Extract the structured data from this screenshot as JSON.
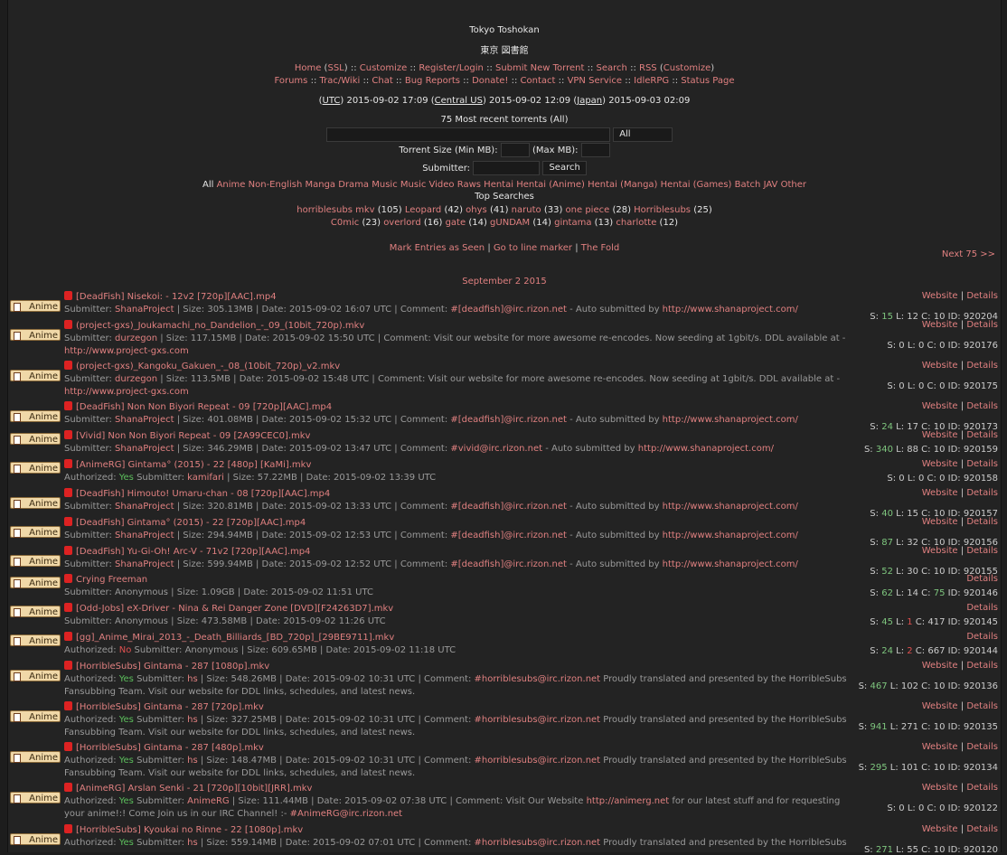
{
  "header": {
    "title": "Tokyo Toshokan",
    "title_jp": "東京 図書館",
    "nav1": [
      "Home",
      "SSL",
      "Customize",
      "Register/Login",
      "Submit New Torrent",
      "Search",
      "RSS",
      "Customize"
    ],
    "nav2": [
      "Forums",
      "Trac/Wiki",
      "Chat",
      "Bug Reports",
      "Donate!",
      "Contact",
      "VPN Service",
      "IdleRPG",
      "Status Page"
    ],
    "time_utc_label": "UTC",
    "time_utc": "2015-09-02 17:09",
    "time_cus_label": "Central US",
    "time_cus": "2015-09-02 12:09",
    "time_jp_label": "Japan",
    "time_jp": "2015-09-03 02:09"
  },
  "search": {
    "recent_label": "75 Most recent torrents (All)",
    "category_value": "All",
    "size_label": "Torrent Size (Min MB):",
    "max_label": "(Max MB):",
    "submitter_label": "Submitter:",
    "search_button": "Search"
  },
  "categories": {
    "all": "All",
    "items": [
      "Anime",
      "Non-English",
      "Manga",
      "Drama",
      "Music",
      "Music Video",
      "Raws",
      "Hentai",
      "Hentai (Anime)",
      "Hentai (Manga)",
      "Hentai (Games)",
      "Batch",
      "JAV",
      "Other"
    ]
  },
  "top_searches": {
    "label": "Top Searches",
    "row1": [
      [
        "horriblesubs mkv",
        "(105)"
      ],
      [
        "Leopard",
        "(42)"
      ],
      [
        "ohys",
        "(41)"
      ],
      [
        "naruto",
        "(33)"
      ],
      [
        "one piece",
        "(28)"
      ],
      [
        "Horriblesubs",
        "(25)"
      ]
    ],
    "row2": [
      [
        "C0mic",
        "(23)"
      ],
      [
        "overlord",
        "(16)"
      ],
      [
        "gate",
        "(14)"
      ],
      [
        "gUNDAM",
        "(14)"
      ],
      [
        "gintama",
        "(13)"
      ],
      [
        "charlotte",
        "(12)"
      ]
    ]
  },
  "markers": {
    "mark_seen": "Mark Entries as Seen",
    "goto": "Go to line marker",
    "fold": "The Fold",
    "next": "Next 75 >>"
  },
  "date_header": "September 2 2015",
  "cat_label": "Anime",
  "link_website": "Website",
  "link_details": "Details",
  "torrents": [
    {
      "name": "[DeadFish] Nisekoi: - 12v2 [720p][AAC].mp4",
      "info": "Submitter: ShanaProject | Size: 305.13MB | Date: 2015-09-02 16:07 UTC | Comment: #[deadfish]@irc.rizon.net - Auto submitted by http://www.shanaproject.com/",
      "s": "15",
      "l": "12",
      "c": "10",
      "id": "920204"
    },
    {
      "name": "(project-gxs)_Joukamachi_no_Dandelion_-_09_(10bit_720p).mkv",
      "info": "Submitter: durzegon | Size: 117.15MB | Date: 2015-09-02 15:50 UTC | Comment: Visit our website for more awesome re-encodes. Now seeding at 1gbit/s. DDL available at - http://www.project-gxs.com",
      "s": "0",
      "l": "0",
      "c": "0",
      "id": "920176"
    },
    {
      "name": "(project-gxs)_Kangoku_Gakuen_-_08_(10bit_720p)_v2.mkv",
      "info": "Submitter: durzegon | Size: 113.5MB | Date: 2015-09-02 15:48 UTC | Comment: Visit our website for more awesome re-encodes. Now seeding at 1gbit/s. DDL available at - http://www.project-gxs.com",
      "s": "0",
      "l": "0",
      "c": "0",
      "id": "920175"
    },
    {
      "name": "[DeadFish] Non Non Biyori Repeat - 09 [720p][AAC].mp4",
      "info": "Submitter: ShanaProject | Size: 401.08MB | Date: 2015-09-02 15:32 UTC | Comment: #[deadfish]@irc.rizon.net - Auto submitted by http://www.shanaproject.com/",
      "s": "24",
      "l": "17",
      "c": "10",
      "id": "920173"
    },
    {
      "name": "[Vivid] Non Non Biyori Repeat - 09 [2A99CEC0].mkv",
      "info": "Submitter: ShanaProject | Size: 346.29MB | Date: 2015-09-02 13:47 UTC | Comment: #vivid@irc.rizon.net - Auto submitted by http://www.shanaproject.com/",
      "s": "340",
      "l": "88",
      "c": "10",
      "id": "920159"
    },
    {
      "name": "[AnimeRG] Gintama° (2015) - 22 [480p] [KaMi].mkv",
      "info": "Authorized: Yes Submitter: kamifari | Size: 57.22MB | Date: 2015-09-02 13:39 UTC",
      "s": "0",
      "l": "0",
      "c": "0",
      "id": "920158"
    },
    {
      "name": "[DeadFish] Himouto! Umaru-chan - 08 [720p][AAC].mp4",
      "info": "Submitter: ShanaProject | Size: 320.81MB | Date: 2015-09-02 13:33 UTC | Comment: #[deadfish]@irc.rizon.net - Auto submitted by http://www.shanaproject.com/",
      "s": "40",
      "l": "15",
      "c": "10",
      "id": "920157"
    },
    {
      "name": "[DeadFish] Gintama° (2015) - 22 [720p][AAC].mp4",
      "info": "Submitter: ShanaProject | Size: 294.94MB | Date: 2015-09-02 12:53 UTC | Comment: #[deadfish]@irc.rizon.net - Auto submitted by http://www.shanaproject.com/",
      "s": "87",
      "l": "32",
      "c": "10",
      "id": "920156"
    },
    {
      "name": "[DeadFish] Yu-Gi-Oh! Arc-V - 71v2 [720p][AAC].mp4",
      "info": "Submitter: ShanaProject | Size: 599.94MB | Date: 2015-09-02 12:52 UTC | Comment: #[deadfish]@irc.rizon.net - Auto submitted by http://www.shanaproject.com/",
      "s": "52",
      "l": "30",
      "c": "10",
      "id": "920155"
    },
    {
      "name": "Crying Freeman",
      "info": "Submitter: Anonymous | Size: 1.09GB | Date: 2015-09-02 11:51 UTC",
      "s": "62",
      "l": "14",
      "c": "75",
      "id": "920146"
    },
    {
      "name": "[Odd-Jobs] eX-Driver - Nina & Rei Danger Zone [DVD][F24263D7].mkv",
      "info": "Submitter: Anonymous | Size: 473.58MB | Date: 2015-09-02 11:26 UTC",
      "s": "45",
      "l": "1",
      "c": "417",
      "id": "920145"
    },
    {
      "name": "[gg]_Anime_Mirai_2013_-_Death_Billiards_[BD_720p]_[29BE9711].mkv",
      "info": "Authorized: No Submitter: Anonymous | Size: 609.65MB | Date: 2015-09-02 11:18 UTC",
      "s": "24",
      "l": "2",
      "c": "667",
      "id": "920144"
    },
    {
      "name": "[HorribleSubs] Gintama - 287 [1080p].mkv",
      "info": "Authorized: Yes Submitter: hs | Size: 548.26MB | Date: 2015-09-02 10:31 UTC | Comment: #horriblesubs@irc.rizon.net Proudly translated and presented by the HorribleSubs Fansubbing Team. Visit our website for DDL links, schedules, and latest news.",
      "s": "467",
      "l": "102",
      "c": "10",
      "id": "920136"
    },
    {
      "name": "[HorribleSubs] Gintama - 287 [720p].mkv",
      "info": "Authorized: Yes Submitter: hs | Size: 327.25MB | Date: 2015-09-02 10:31 UTC | Comment: #horriblesubs@irc.rizon.net Proudly translated and presented by the HorribleSubs Fansubbing Team. Visit our website for DDL links, schedules, and latest news.",
      "s": "941",
      "l": "271",
      "c": "10",
      "id": "920135"
    },
    {
      "name": "[HorribleSubs] Gintama - 287 [480p].mkv",
      "info": "Authorized: Yes Submitter: hs | Size: 148.47MB | Date: 2015-09-02 10:31 UTC | Comment: #horriblesubs@irc.rizon.net Proudly translated and presented by the HorribleSubs Fansubbing Team. Visit our website for DDL links, schedules, and latest news.",
      "s": "295",
      "l": "101",
      "c": "10",
      "id": "920134"
    },
    {
      "name": "[AnimeRG] Arslan Senki - 21 [720p][10bit][JRR].mkv",
      "info": "Authorized: Yes Submitter: AnimeRG | Size: 111.44MB | Date: 2015-09-02 07:38 UTC | Comment: Visit Our Website http://animerg.net for our latest stuff and for requesting your anime!:! Come Join us in our IRC Channel! :- #AnimeRG@irc.rizon.net",
      "s": "0",
      "l": "0",
      "c": "0",
      "id": "920122"
    },
    {
      "name": "[HorribleSubs] Kyoukai no Rinne - 22 [1080p].mkv",
      "info": "Authorized: Yes Submitter: hs | Size: 559.14MB | Date: 2015-09-02 07:01 UTC | Comment: #horriblesubs@irc.rizon.net Proudly translated and presented by the HorribleSubs",
      "s": "271",
      "l": "55",
      "c": "10",
      "id": "920120"
    }
  ]
}
